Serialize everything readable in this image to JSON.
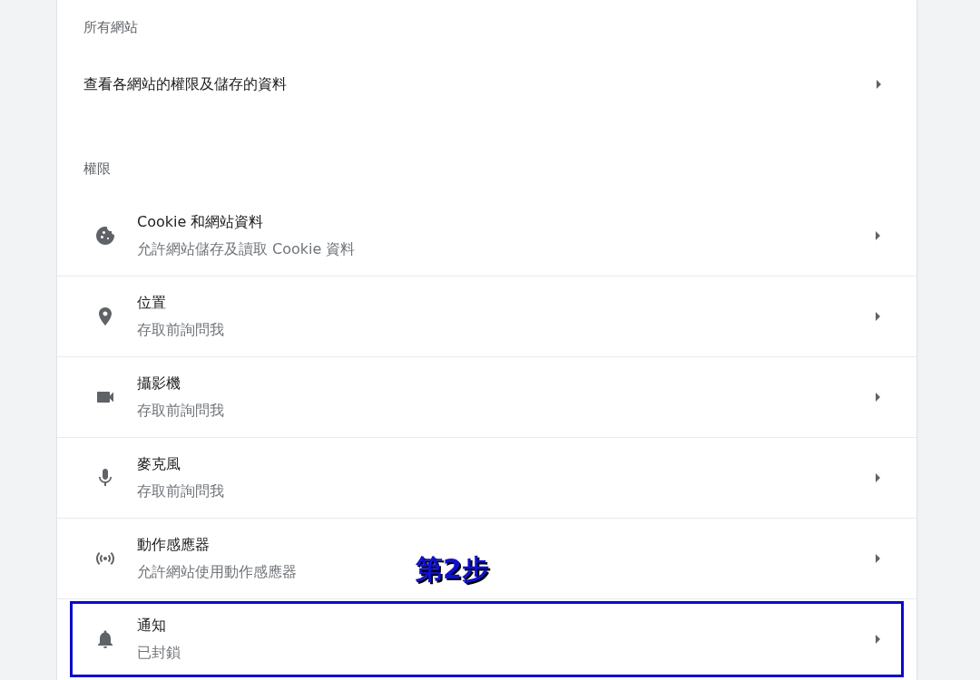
{
  "all_sites": {
    "heading": "所有網站",
    "link": {
      "label": "查看各網站的權限及儲存的資料"
    }
  },
  "permissions": {
    "heading": "權限",
    "items": [
      {
        "kind": "cookie",
        "title": "Cookie 和網站資料",
        "subtitle": "允許網站儲存及讀取 Cookie 資料",
        "highlighted": false
      },
      {
        "kind": "location",
        "title": "位置",
        "subtitle": "存取前詢問我",
        "highlighted": false
      },
      {
        "kind": "camera",
        "title": "攝影機",
        "subtitle": "存取前詢問我",
        "highlighted": false
      },
      {
        "kind": "microphone",
        "title": "麥克風",
        "subtitle": "存取前詢問我",
        "highlighted": false
      },
      {
        "kind": "sensors",
        "title": "動作感應器",
        "subtitle": "允許網站使用動作感應器",
        "highlighted": false,
        "annotation": "第2步"
      },
      {
        "kind": "notifications",
        "title": "通知",
        "subtitle": "已封鎖",
        "highlighted": true
      }
    ]
  }
}
